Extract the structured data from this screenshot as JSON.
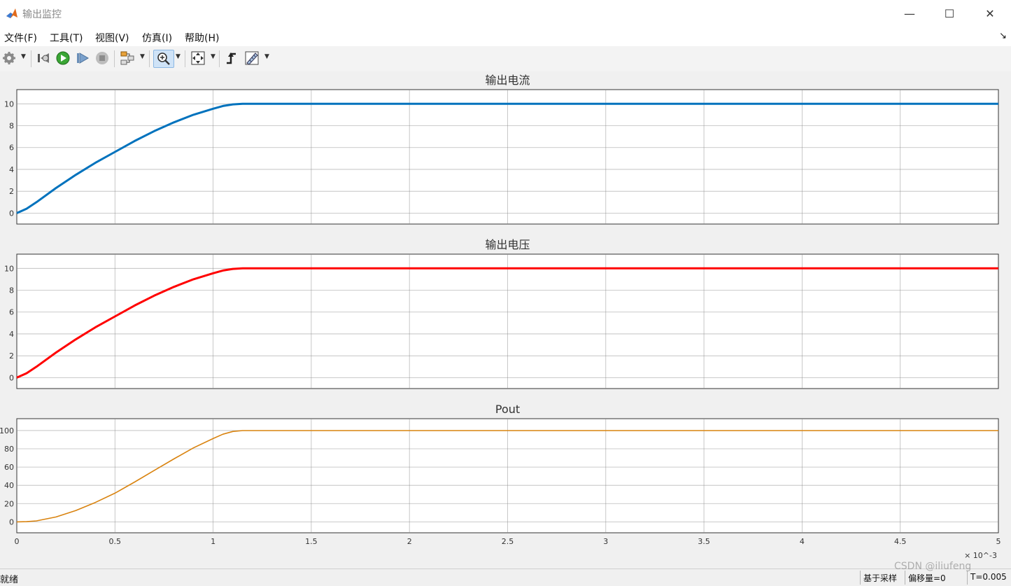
{
  "window": {
    "title": "输出监控",
    "controls": {
      "minimize": "—",
      "maximize": "☐",
      "close": "✕"
    }
  },
  "menu": {
    "items": [
      "文件(F)",
      "工具(T)",
      "视图(V)",
      "仿真(I)",
      "帮助(H)"
    ],
    "overflow_icon": "dock-arrow-icon"
  },
  "toolbar": {
    "buttons": [
      {
        "name": "settings",
        "icon": "gear-icon",
        "dropdown": true
      },
      {
        "name": "step-back",
        "icon": "step-back-icon"
      },
      {
        "name": "run",
        "icon": "run-icon"
      },
      {
        "name": "step-forward",
        "icon": "step-forward-icon"
      },
      {
        "name": "stop",
        "icon": "stop-icon"
      },
      {
        "name": "highlight",
        "icon": "highlight-block-icon",
        "dropdown": true
      },
      {
        "name": "zoom",
        "icon": "zoom-in-icon",
        "dropdown": true,
        "active": true
      },
      {
        "name": "autoscale",
        "icon": "autoscale-icon",
        "dropdown": true
      },
      {
        "name": "triggers",
        "icon": "trigger-icon"
      },
      {
        "name": "measurements",
        "icon": "ruler-icon",
        "dropdown": true
      }
    ]
  },
  "status": {
    "ready": "就绪",
    "sample_mode": "基于采样",
    "offset": "偏移量=0",
    "time": "T=0.005"
  },
  "watermark": "CSDN @iliufeng",
  "colors": {
    "current": "#0072bd",
    "voltage": "#ff0000",
    "pout": "#d9830f",
    "grid": "#8c8c8c"
  },
  "chart_data": [
    {
      "type": "line",
      "title": "输出电流",
      "xlabel": "",
      "ylabel": "",
      "xlim": [
        0,
        0.005
      ],
      "ylim": [
        -1,
        11.3
      ],
      "yticks": [
        0,
        2,
        4,
        6,
        8,
        10
      ],
      "xticks": [
        0,
        0.0005,
        0.001,
        0.0015,
        0.002,
        0.0025,
        0.003,
        0.0035,
        0.004,
        0.0045,
        0.005
      ],
      "grid": true,
      "series": [
        {
          "color": "#0072bd",
          "x": [
            0,
            5e-05,
            0.0001,
            0.0002,
            0.0003,
            0.0004,
            0.0005,
            0.0006,
            0.0007,
            0.0008,
            0.0009,
            0.001,
            0.00105,
            0.0011,
            0.00115,
            0.0012,
            0.0015,
            0.002,
            0.003,
            0.004,
            0.005
          ],
          "y": [
            0,
            0.4,
            1.0,
            2.3,
            3.5,
            4.6,
            5.6,
            6.6,
            7.5,
            8.3,
            9.0,
            9.55,
            9.8,
            9.95,
            10,
            10,
            10,
            10,
            10,
            10,
            10
          ]
        }
      ]
    },
    {
      "type": "line",
      "title": "输出电压",
      "xlabel": "",
      "ylabel": "",
      "xlim": [
        0,
        0.005
      ],
      "ylim": [
        -1,
        11.3
      ],
      "yticks": [
        0,
        2,
        4,
        6,
        8,
        10
      ],
      "xticks": [
        0,
        0.0005,
        0.001,
        0.0015,
        0.002,
        0.0025,
        0.003,
        0.0035,
        0.004,
        0.0045,
        0.005
      ],
      "grid": true,
      "series": [
        {
          "color": "#ff0000",
          "x": [
            0,
            5e-05,
            0.0001,
            0.0002,
            0.0003,
            0.0004,
            0.0005,
            0.0006,
            0.0007,
            0.0008,
            0.0009,
            0.001,
            0.00105,
            0.0011,
            0.00115,
            0.0012,
            0.0015,
            0.002,
            0.003,
            0.004,
            0.005
          ],
          "y": [
            0,
            0.4,
            1.0,
            2.3,
            3.5,
            4.6,
            5.6,
            6.6,
            7.5,
            8.3,
            9.0,
            9.55,
            9.8,
            9.95,
            10,
            10,
            10,
            10,
            10,
            10,
            10
          ]
        }
      ]
    },
    {
      "type": "line",
      "title": "Pout",
      "xlabel": "",
      "ylabel": "",
      "xlim": [
        0,
        0.005
      ],
      "ylim": [
        -12,
        113
      ],
      "yticks": [
        0,
        20,
        40,
        60,
        80,
        100
      ],
      "xticks": [
        0,
        0.0005,
        0.001,
        0.0015,
        0.002,
        0.0025,
        0.003,
        0.0035,
        0.004,
        0.0045,
        0.005
      ],
      "xticklabels": [
        "0",
        "0.5",
        "1",
        "1.5",
        "2",
        "2.5",
        "3",
        "3.5",
        "4",
        "4.5",
        "5"
      ],
      "xexponent": "× 10^-3",
      "grid": true,
      "series": [
        {
          "color": "#d9830f",
          "x": [
            0,
            5e-05,
            0.0001,
            0.0002,
            0.0003,
            0.0004,
            0.0005,
            0.0006,
            0.0007,
            0.0008,
            0.0009,
            0.001,
            0.00105,
            0.0011,
            0.00115,
            0.0012,
            0.0015,
            0.002,
            0.003,
            0.004,
            0.005
          ],
          "y": [
            0,
            0.2,
            1.0,
            5.3,
            12.3,
            21.2,
            31.4,
            43.6,
            56.3,
            68.9,
            81.0,
            91.2,
            96.0,
            99.0,
            100,
            100,
            100,
            100,
            100,
            100,
            100
          ]
        }
      ]
    }
  ]
}
